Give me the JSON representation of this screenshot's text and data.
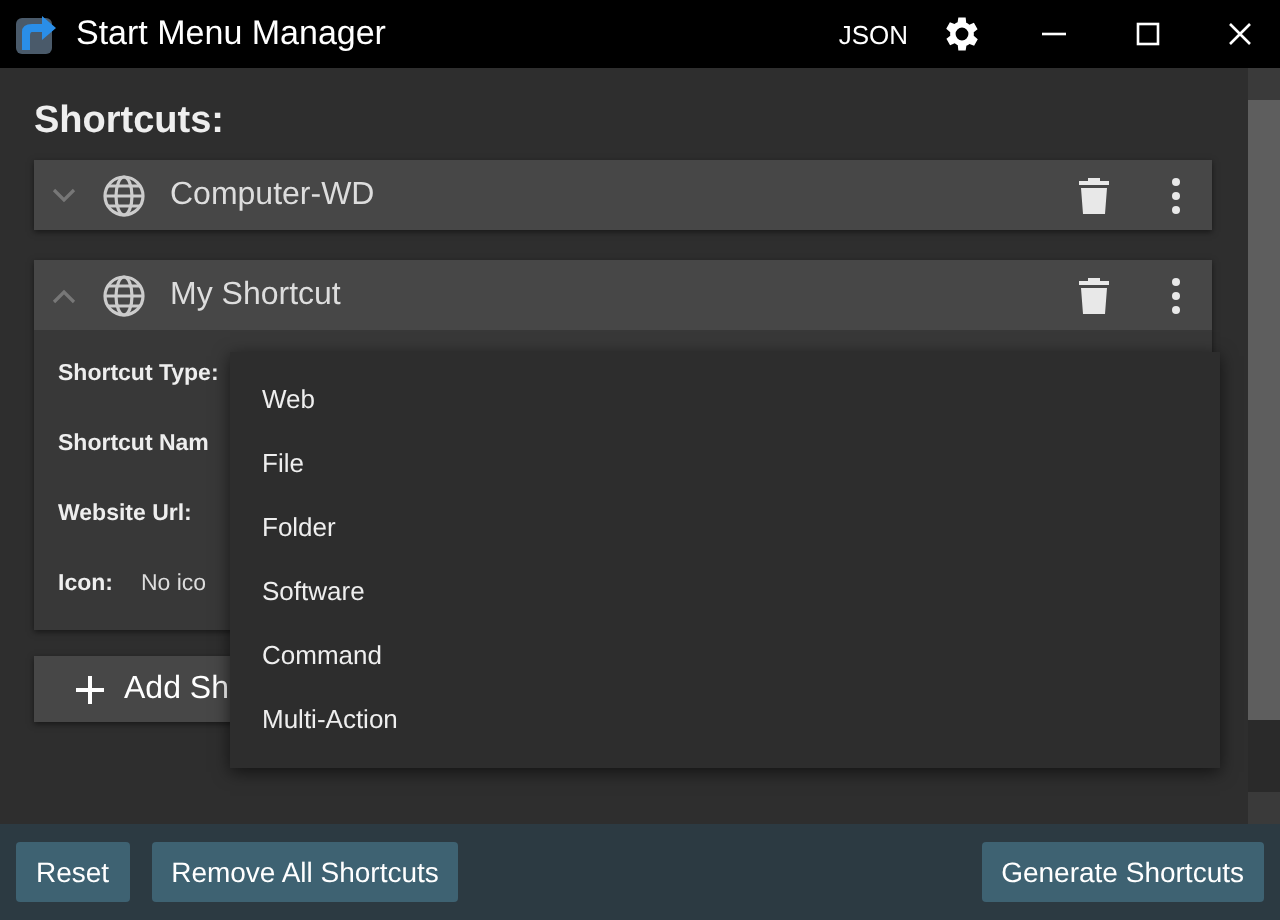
{
  "window": {
    "title": "Start Menu Manager",
    "json_button": "JSON"
  },
  "heading": "Shortcuts:",
  "shortcuts": [
    {
      "name": "Computer-WD",
      "expanded": false
    },
    {
      "name": "My Shortcut",
      "expanded": true
    }
  ],
  "form_fields": [
    {
      "label": "Shortcut Type:"
    },
    {
      "label": "Shortcut Nam"
    },
    {
      "label": "Website Url:"
    },
    {
      "label": "Icon:",
      "value": "No ico"
    }
  ],
  "add_button": "Add Sh",
  "dropdown": {
    "options": [
      {
        "label": "Web"
      },
      {
        "label": "File"
      },
      {
        "label": "Folder"
      },
      {
        "label": "Software"
      },
      {
        "label": "Command"
      },
      {
        "label": "Multi-Action"
      }
    ]
  },
  "footer": {
    "left_buttons": [
      "Reset",
      "Remove All Shortcuts"
    ],
    "right_button": "Generate Shortcuts"
  }
}
